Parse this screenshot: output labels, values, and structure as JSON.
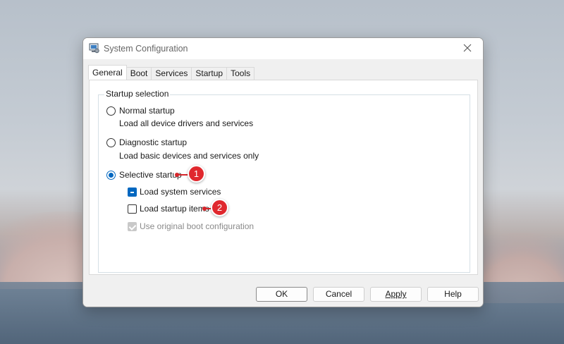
{
  "window": {
    "title": "System Configuration",
    "icon": "system-config-icon",
    "close_icon": "close-icon"
  },
  "tabs": [
    "General",
    "Boot",
    "Services",
    "Startup",
    "Tools"
  ],
  "active_tab": "General",
  "startup_selection": {
    "legend": "Startup selection",
    "normal": {
      "label": "Normal startup",
      "description": "Load all device drivers and services",
      "selected": false
    },
    "diagnostic": {
      "label": "Diagnostic startup",
      "description": "Load basic devices and services only",
      "selected": false
    },
    "selective": {
      "label": "Selective startup",
      "selected": true,
      "options": {
        "load_system_services": {
          "label": "Load system services",
          "state": "indeterminate"
        },
        "load_startup_items": {
          "label": "Load startup items",
          "state": "unchecked"
        },
        "use_original_boot": {
          "label": "Use original boot configuration",
          "state": "checked-disabled"
        }
      }
    }
  },
  "callouts": [
    {
      "number": "1",
      "target": "Selective startup"
    },
    {
      "number": "2",
      "target": "Load startup items"
    }
  ],
  "buttons": {
    "ok": "OK",
    "cancel": "Cancel",
    "apply": "Apply",
    "help": "Help"
  },
  "colors": {
    "accent": "#0067c0",
    "callout_red": "#e0282e"
  }
}
